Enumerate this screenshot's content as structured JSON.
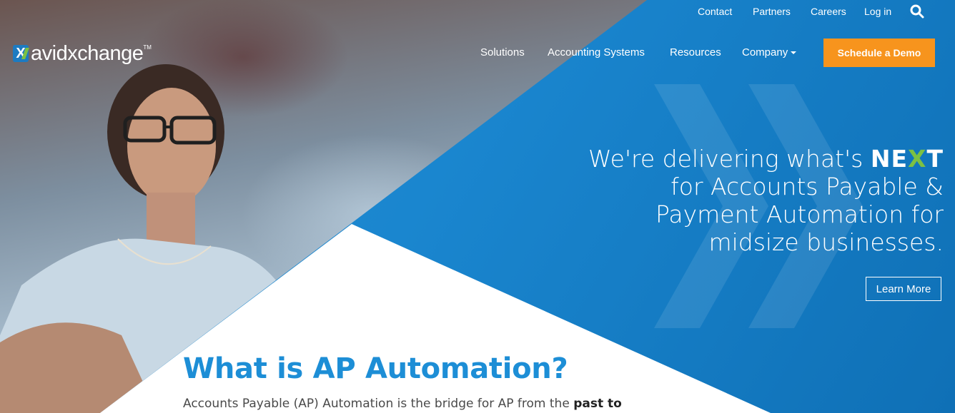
{
  "brand": {
    "logo_text": "avidxchange",
    "trademark": "TM",
    "logo_mark": "X"
  },
  "utility_nav": {
    "contact": "Contact",
    "partners": "Partners",
    "careers": "Careers",
    "login": "Log in",
    "search_icon": "search-icon"
  },
  "main_nav": {
    "solutions": "Solutions",
    "accounting_systems": "Accounting Systems",
    "resources": "Resources",
    "company": "Company",
    "cta": "Schedule a Demo"
  },
  "hero": {
    "line1_prefix": "We're delivering what's ",
    "line1_next_a": "NE",
    "line1_next_x": "X",
    "line1_next_b": "T",
    "line2": "for Accounts Payable &",
    "line3": "Payment Automation for",
    "line4": "midsize businesses.",
    "button": "Learn More"
  },
  "content": {
    "title": "What is AP Automation?",
    "body_prefix": "Accounts Payable (AP) Automation is the bridge for AP from the ",
    "body_bold": "past to"
  },
  "colors": {
    "accent_blue": "#1d8ed6",
    "hero_blue": "#1a86cf",
    "cta_orange": "#f7941d",
    "brand_green": "#7cc143"
  }
}
